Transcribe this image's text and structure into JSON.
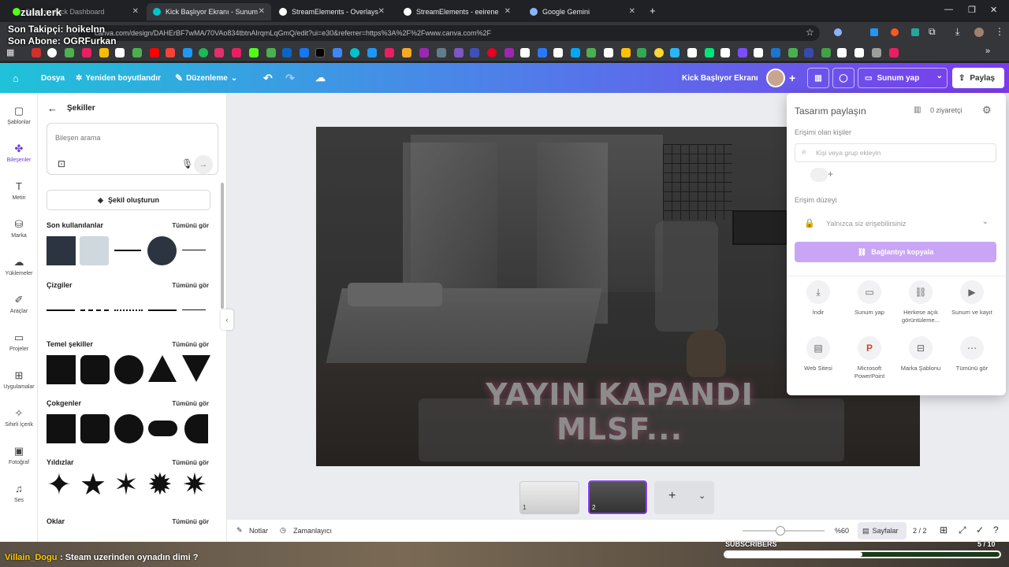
{
  "browser": {
    "tabs": [
      {
        "label": "Stream · Kick Dashboard",
        "color": "#53fc18"
      },
      {
        "label": "Kick Başlıyor Ekranı - Sunum",
        "color": "#00c4cc"
      },
      {
        "label": "StreamElements - Overlays",
        "color": "#ffffff"
      },
      {
        "label": "StreamElements - eeirene",
        "color": "#ffffff"
      },
      {
        "label": "Google Gemini",
        "color": "#8ab4f8"
      }
    ],
    "url": "canva.com/design/DAHErBF7wMA/70VAo834tbtnAIrqmLqGmQ/edit?ui=e30&referrer=https%3A%2F%2Fwww.canva.com%2F"
  },
  "stream_overlay": {
    "channel": "zulal.erk",
    "follower_line": "Son Takipçi: hoikelnn",
    "sub_line": "Son Abone: OGRFurkan",
    "chat_user": "Villain_Dogu",
    "chat_message": ": Steam uzerinden oynadın dimi ?",
    "subscribers_label": "SUBSCRIBERS",
    "subscribers_count": "5 / 10",
    "subscribers_progress": 0.5
  },
  "canva_header": {
    "file": "Dosya",
    "resize": "Yeniden boyutlandır",
    "edit": "Düzenleme",
    "doc_title": "Kick Başlıyor Ekranı",
    "present": "Sunum yap",
    "share": "Paylaş"
  },
  "rail": [
    {
      "label": "Şablonlar",
      "icon": "template-icon"
    },
    {
      "label": "Bileşenler",
      "icon": "elements-icon"
    },
    {
      "label": "Metin",
      "icon": "text-icon"
    },
    {
      "label": "Marka",
      "icon": "brand-icon"
    },
    {
      "label": "Yüklemeler",
      "icon": "upload-icon"
    },
    {
      "label": "Araçlar",
      "icon": "tools-icon"
    },
    {
      "label": "Projeler",
      "icon": "folder-icon"
    },
    {
      "label": "Uygulamalar",
      "icon": "apps-icon"
    },
    {
      "label": "Sihirli İçerik",
      "icon": "magic-icon"
    },
    {
      "label": "Fotoğraf",
      "icon": "photo-icon"
    },
    {
      "label": "Ses",
      "icon": "music-icon"
    }
  ],
  "panel": {
    "title": "Şekiller",
    "search_placeholder": "Bileşen arama",
    "create_shape": "Şekil oluşturun",
    "see_all": "Tümünü gör",
    "sections": [
      "Son kullanılanlar",
      "Çizgiler",
      "Temel şekiller",
      "Çokgenler",
      "Yıldızlar",
      "Oklar"
    ]
  },
  "design": {
    "headline": "YAYIN KAPANDI MLSF..."
  },
  "share_panel": {
    "title": "Tasarım paylaşın",
    "visitors": "0 ziyaretçi",
    "access_people": "Erişimi olan kişiler",
    "people_placeholder": "Kişi veya grup ekleyin",
    "access_level": "Erişim düzeyi",
    "access_value": "Yalnızca siz erişebilirsiniz",
    "copy_link": "Bağlantıyı kopyala",
    "options": [
      {
        "label": "İndir",
        "icon": "download-icon"
      },
      {
        "label": "Sunum yap",
        "icon": "present-icon"
      },
      {
        "label": "Herkese açık görüntüleme...",
        "icon": "link-icon"
      },
      {
        "label": "Sunum ve kayıt",
        "icon": "record-icon"
      },
      {
        "label": "Web Sitesi",
        "icon": "website-icon"
      },
      {
        "label": "Microsoft PowerPoint",
        "icon": "powerpoint-icon"
      },
      {
        "label": "Marka Şablonu",
        "icon": "brand-template-icon"
      },
      {
        "label": "Tümünü gör",
        "icon": "more-icon"
      }
    ]
  },
  "bottom": {
    "notes": "Notlar",
    "timer": "Zamanlayıcı",
    "zoom": "%60",
    "pages": "Sayfalar",
    "page_count": "2 / 2",
    "page1": "1",
    "page2": "2"
  }
}
